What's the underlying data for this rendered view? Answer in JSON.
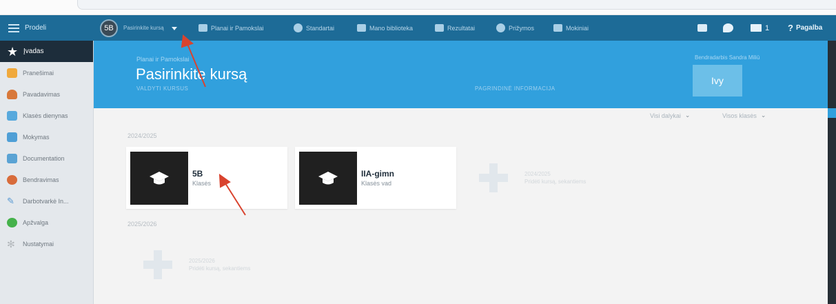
{
  "topbar": {
    "menu_label": "Prodeli",
    "course_picker_label": "Pasirinkite kursą",
    "course_avatar_text": "5B",
    "nav": [
      {
        "label": "Planai ir Pamokslai"
      },
      {
        "label": "Standartai"
      },
      {
        "label": "Mano biblioteka"
      },
      {
        "label": "Rezultatai"
      },
      {
        "label": "Prižymos"
      },
      {
        "label": "Mokiniai"
      }
    ],
    "mail_count": "1",
    "help_label": "Pagalba"
  },
  "sidebar": {
    "items": [
      {
        "label": "Įvadas",
        "icon": "star-icon",
        "color": "#ffffff"
      },
      {
        "label": "Pranešimai",
        "icon": "envelope-icon",
        "color": "#f0a93c"
      },
      {
        "label": "Pavadavimas",
        "icon": "person-icon",
        "color": "#d8783a"
      },
      {
        "label": "Klasės dienynas",
        "icon": "gradebook-icon",
        "color": "#57a9dd"
      },
      {
        "label": "Mokymas",
        "icon": "teaching-icon",
        "color": "#4f9fd6"
      },
      {
        "label": "Documentation",
        "icon": "documentation-icon",
        "color": "#5aa3d4"
      },
      {
        "label": "Bendravimas",
        "icon": "communication-icon",
        "color": "#d86c3b"
      },
      {
        "label": "Darbotvarkė In...",
        "icon": "pencil-icon",
        "color": "#5a9ad3"
      },
      {
        "label": "Apžvalga",
        "icon": "overview-icon",
        "color": "#45b24b"
      },
      {
        "label": "Nustatymai",
        "icon": "gear-icon",
        "color": "#b4b9bd"
      }
    ]
  },
  "header": {
    "breadcrumb": "Planai ir Pamokslai",
    "title": "Pasirinkite kursą",
    "subtitle": "VALDYTI KURSUS",
    "info_label": "PAGRINDINĖ INFORMACIJA",
    "teacher_label": "Bendradarbis Sandra Miliū",
    "teacher_box": "Ivy",
    "accent": "#31a0dd"
  },
  "filters": {
    "subjects": "Visi dalykai",
    "classes": "Visos klasės"
  },
  "sections": [
    {
      "year": "2024/2025",
      "courses": [
        {
          "name": "5B",
          "type": "Klasės"
        },
        {
          "name": "IIA-gimn",
          "type": "Klasės vad"
        }
      ],
      "add_tile": {
        "line1": "2024/2025",
        "line2": "Pridėti kursą, sekantiems"
      }
    },
    {
      "year": "2025/2026",
      "add_tile": {
        "line1": "2025/2026",
        "line2": "Pridėti kursą, sekantiems"
      }
    }
  ],
  "annotation_color": "#d9432e"
}
